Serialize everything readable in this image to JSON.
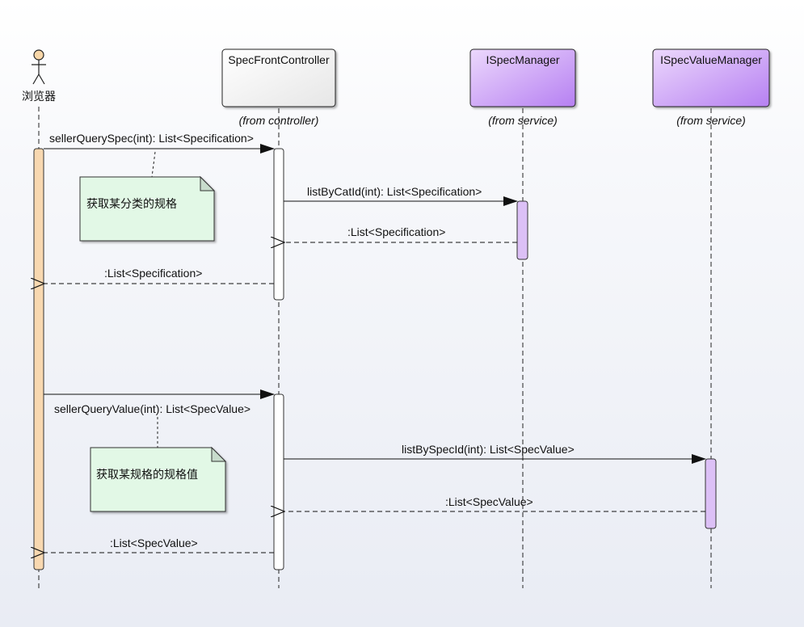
{
  "actor": {
    "label": "浏览器"
  },
  "participants": [
    {
      "id": "controller",
      "name": "SpecFrontController",
      "origin": "(from controller)"
    },
    {
      "id": "specmgr",
      "name": "ISpecManager",
      "origin": "(from service)"
    },
    {
      "id": "valmgr",
      "name": "ISpecValueManager",
      "origin": "(from service)"
    }
  ],
  "messages": [
    {
      "label": "sellerQuerySpec(int): List<Specification>"
    },
    {
      "label": "listByCatId(int): List<Specification>"
    },
    {
      "label": ":List<Specification>"
    },
    {
      "label": ":List<Specification>"
    },
    {
      "label": "sellerQueryValue(int): List<SpecValue>"
    },
    {
      "label": "listBySpecId(int): List<SpecValue>"
    },
    {
      "label": ":List<SpecValue>"
    },
    {
      "label": ":List<SpecValue>"
    }
  ],
  "notes": [
    {
      "text": "获取某分类的规格"
    },
    {
      "text": "获取某规格的规格值"
    }
  ],
  "colors": {
    "actor_activation": "#f8d8b0",
    "controller_box": "#ffffff",
    "service_box": "#d2a8f8",
    "service_activation": "#dcc0f6",
    "note_fill": "#e2f8e6"
  }
}
